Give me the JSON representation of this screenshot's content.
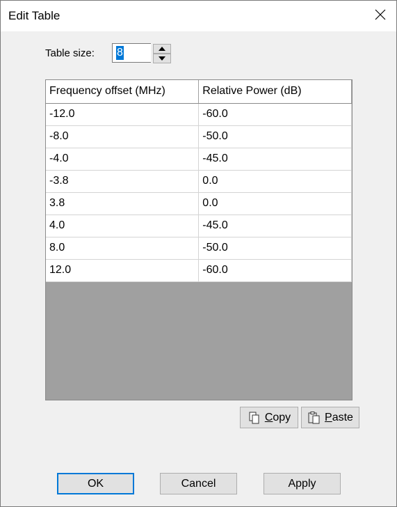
{
  "window": {
    "title": "Edit Table"
  },
  "table_size": {
    "label": "Table size:",
    "value": "8"
  },
  "table": {
    "columns": [
      "Frequency offset (MHz)",
      "Relative Power (dB)"
    ],
    "rows": [
      [
        "-12.0",
        "-60.0"
      ],
      [
        "-8.0",
        "-50.0"
      ],
      [
        "-4.0",
        "-45.0"
      ],
      [
        "-3.8",
        "0.0"
      ],
      [
        "3.8",
        "0.0"
      ],
      [
        "4.0",
        "-45.0"
      ],
      [
        "8.0",
        "-50.0"
      ],
      [
        "12.0",
        "-60.0"
      ]
    ]
  },
  "clipboard": {
    "copy_label": "Copy",
    "paste_label": "Paste"
  },
  "footer": {
    "ok_label": "OK",
    "cancel_label": "Cancel",
    "apply_label": "Apply"
  },
  "icons": {
    "close": "close-icon",
    "copy": "copy-icon",
    "paste": "paste-icon",
    "spin_up": "chevron-up-icon",
    "spin_down": "chevron-down-icon"
  },
  "colors": {
    "selection": "#0078d7",
    "empty_area": "#a0a0a0",
    "default_button_border": "#0078d7"
  }
}
